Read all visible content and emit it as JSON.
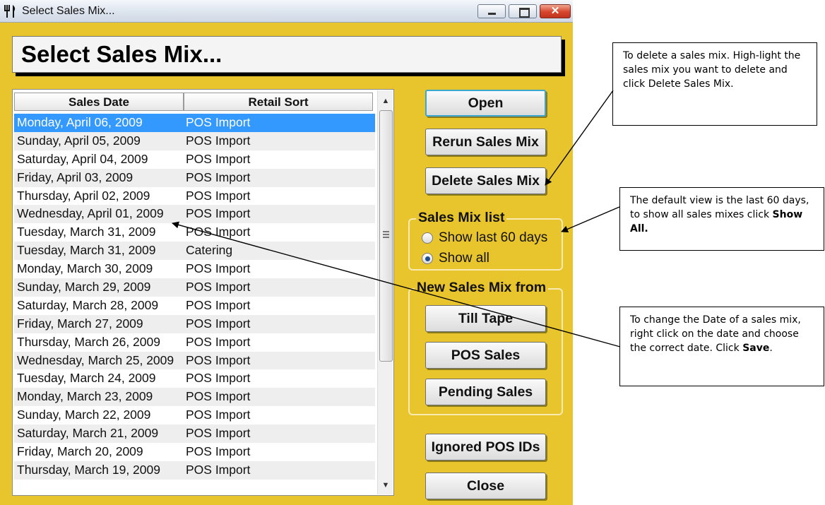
{
  "window": {
    "title": "Select Sales Mix...",
    "heading": "Select Sales Mix..."
  },
  "list": {
    "columns": [
      "Sales Date",
      "Retail Sort"
    ],
    "rows": [
      {
        "date": "Monday, April 06, 2009",
        "sort": "POS Import",
        "selected": true
      },
      {
        "date": "Sunday, April 05, 2009",
        "sort": "POS Import"
      },
      {
        "date": "Saturday, April 04, 2009",
        "sort": "POS Import"
      },
      {
        "date": "Friday, April 03, 2009",
        "sort": "POS Import"
      },
      {
        "date": "Thursday, April 02, 2009",
        "sort": "POS Import"
      },
      {
        "date": "Wednesday, April 01, 2009",
        "sort": "POS Import"
      },
      {
        "date": "Tuesday, March 31, 2009",
        "sort": "POS Import"
      },
      {
        "date": "Tuesday, March 31, 2009",
        "sort": "Catering"
      },
      {
        "date": "Monday, March 30, 2009",
        "sort": "POS Import"
      },
      {
        "date": "Sunday, March 29, 2009",
        "sort": "POS Import"
      },
      {
        "date": "Saturday, March 28, 2009",
        "sort": "POS Import"
      },
      {
        "date": "Friday, March 27, 2009",
        "sort": "POS Import"
      },
      {
        "date": "Thursday, March 26, 2009",
        "sort": "POS Import"
      },
      {
        "date": "Wednesday, March 25, 2009",
        "sort": "POS Import"
      },
      {
        "date": "Tuesday, March 24, 2009",
        "sort": "POS Import"
      },
      {
        "date": "Monday, March 23, 2009",
        "sort": "POS Import"
      },
      {
        "date": "Sunday, March 22, 2009",
        "sort": "POS Import"
      },
      {
        "date": "Saturday, March 21, 2009",
        "sort": "POS Import"
      },
      {
        "date": "Friday, March 20, 2009",
        "sort": "POS Import"
      },
      {
        "date": "Thursday, March 19, 2009",
        "sort": "POS Import"
      }
    ]
  },
  "buttons": {
    "open": "Open",
    "rerun": "Rerun Sales Mix",
    "delete": "Delete Sales Mix",
    "till_tape": "Till Tape",
    "pos_sales": "POS Sales",
    "pending_sales": "Pending Sales",
    "ignored_pos_ids": "Ignored POS IDs",
    "close": "Close"
  },
  "sales_mix_list": {
    "legend": "Sales Mix list",
    "options": [
      {
        "label": "Show last 60 days",
        "selected": false
      },
      {
        "label": "Show all",
        "selected": true
      }
    ]
  },
  "new_sales_mix": {
    "legend": "New Sales Mix from"
  },
  "notes": {
    "delete": "To delete a sales mix.  High-light the sales mix you want to delete and click Delete Sales Mix.",
    "default_view_pre": "The default view is the last 60 days, to show all sales mixes click ",
    "default_view_bold": "Show All.",
    "change_date_pre": "To change the Date of a sales mix, right click on the date and choose the correct date. Click ",
    "change_date_bold": "Save",
    "change_date_post": "."
  },
  "colors": {
    "window_bg": "#e8c52c",
    "selection": "#3399ff",
    "focus_border": "#3aa6d2"
  },
  "icons": {
    "app": "utensils-icon",
    "minimize": "minimize-icon",
    "maximize": "maximize-icon",
    "close": "close-icon"
  }
}
